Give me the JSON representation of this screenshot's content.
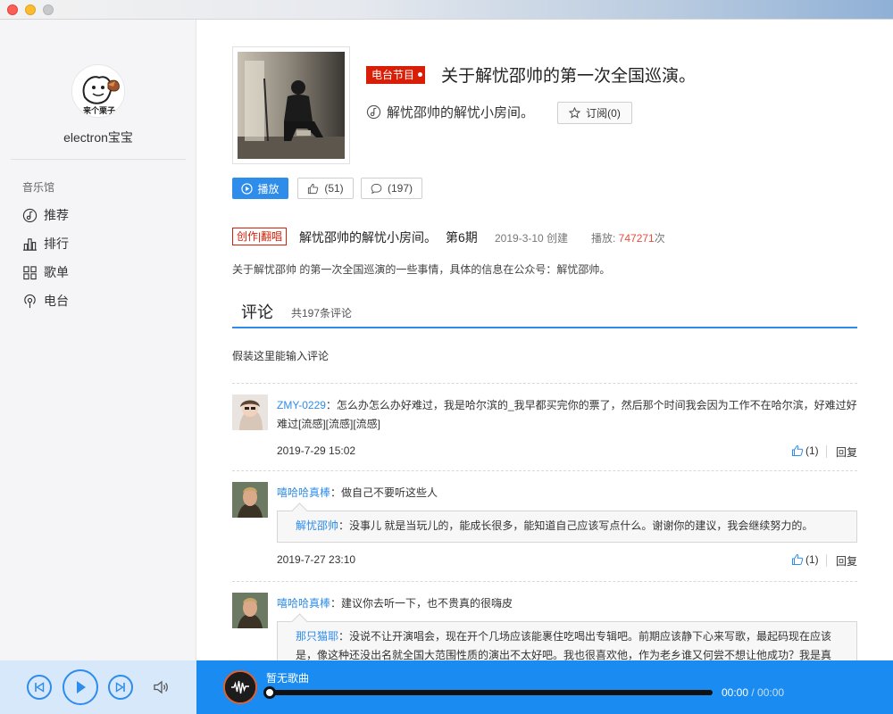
{
  "sidebar": {
    "username": "electron宝宝",
    "section_label": "音乐馆",
    "items": [
      {
        "label": "推荐",
        "icon": "music-note-icon"
      },
      {
        "label": "排行",
        "icon": "ranking-icon"
      },
      {
        "label": "歌单",
        "icon": "playlist-icon"
      },
      {
        "label": "电台",
        "icon": "radio-icon"
      }
    ],
    "avatar_text": "来个栗子"
  },
  "program": {
    "tag": "电台节目",
    "title": "关于解忧邵帅的第一次全国巡演。",
    "dj_name": "解忧邵帅的解忧小房间。",
    "subscribe_label": "订阅(0)",
    "play_label": "播放",
    "like_label": "(51)",
    "comment_label": "(197)",
    "creative_tag": "创作|翻唱",
    "episode_title": "解忧邵帅的解忧小房间。",
    "episode_no": "第6期",
    "date": "2019-3-10 创建",
    "plays_prefix": "播放: ",
    "plays_count": "747271",
    "plays_suffix": "次",
    "description": "关于解忧邵帅  的第一次全国巡演的一些事情，具体的信息在公众号：解忧邵帅。"
  },
  "comments_section": {
    "tab_label": "评论",
    "count_label": "共197条评论",
    "input_placeholder": "假装这里能输入评论",
    "reply_label": "回复",
    "comments": [
      {
        "user": "ZMY-0229",
        "text": "：怎么办怎么办好难过，我是哈尔滨的_我早都买完你的票了，然后那个时间我会因为工作不在哈尔滨，好难过好难过[流感][流感][流感]",
        "time": "2019-7-29 15:02",
        "likes": "(1)"
      },
      {
        "user": "嘻哈哈真棒",
        "text": "：做自己不要听这些人",
        "reply_user": "解忧邵帅",
        "reply_text": "：没事儿 就是当玩儿的，能成长很多，能知道自己应该写点什么。谢谢你的建议，我会继续努力的。",
        "time": "2019-7-27 23:10",
        "likes": "(1)"
      },
      {
        "user": "嘻哈哈真棒",
        "text": "：建议你去听一下，也不贵真的很嗨皮",
        "reply_user": "那只猫耶",
        "reply_text": "：没说不让开演唱会，现在开个几场应该能裹住吃喝出专辑吧。前期应该静下心来写歌，最起码现在应该是，像这种还没出名就全国大范围性质的演出不太好吧。我也很喜欢他，作为老乡谁又何尝不想让他成功？我是真"
      }
    ]
  },
  "player": {
    "song_name": "暂无歌曲",
    "current_time": "00:00",
    "total_time": " / 00:00",
    "progress": 0
  },
  "colors": {
    "accent": "#2e8ceb",
    "player_bar": "#1a8bf0",
    "tag_red": "#d81e06",
    "sidebar_bg": "#f5f5f7"
  }
}
